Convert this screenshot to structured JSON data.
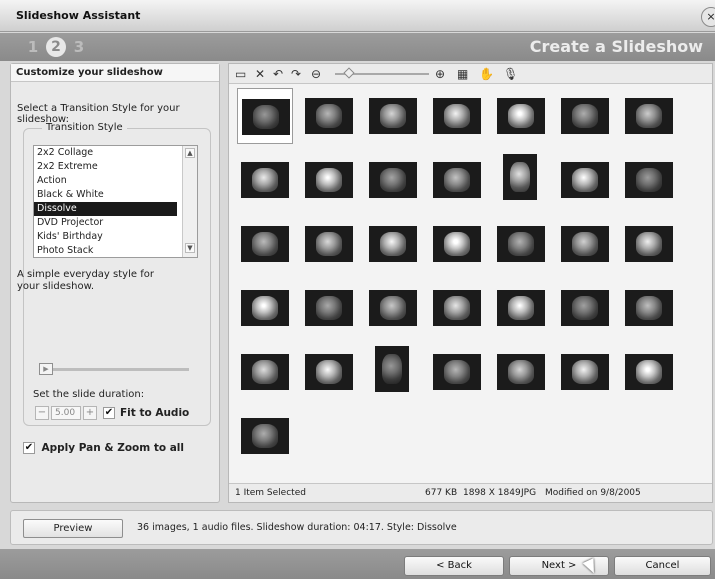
{
  "window": {
    "title": "Slideshow Assistant",
    "close_glyph": "×"
  },
  "wizard": {
    "steps": [
      "1",
      "2",
      "3"
    ],
    "active_step": "2",
    "heading": "Create a Slideshow"
  },
  "left_panel": {
    "title": "Customize your slideshow",
    "prompt": "Select a Transition Style for your slideshow:",
    "group_label": "Transition Style",
    "styles": [
      "2x2 Collage",
      "2x2 Extreme",
      "Action",
      "Black & White",
      "Dissolve",
      "DVD Projector",
      "Kids' Birthday",
      "Photo Stack"
    ],
    "selected_style": "Dissolve",
    "description": "A simple everyday style for your slideshow.",
    "duration_label": "Set the slide duration:",
    "duration_value": "5.00",
    "fit_to_audio_label": "Fit to Audio",
    "fit_to_audio_checked": true,
    "pan_zoom_label": "Apply Pan & Zoom to all",
    "pan_zoom_checked": true
  },
  "toolbar": {
    "icons": [
      "monitor-icon",
      "delete-icon",
      "rotate-left-icon",
      "rotate-right-icon",
      "zoom-out-icon",
      "zoom-slider",
      "zoom-in-icon",
      "view-options-icon",
      "pan-hand-icon",
      "microphone-icon"
    ]
  },
  "photos": {
    "count": 36,
    "selected_index": 0
  },
  "status": {
    "selection": "1 Item Selected",
    "size": "677 KB",
    "dimensions": "1898 X 1849",
    "format": "JPG",
    "modified": "Modified on 9/8/2005"
  },
  "info": {
    "preview_label": "Preview",
    "summary": "36 images,  1 audio files. Slideshow duration: 04:17. Style: Dissolve"
  },
  "footer": {
    "back_label": "< Back",
    "next_label": "Next  >",
    "cancel_label": "Cancel"
  },
  "colors": {
    "header_gray": "#8a8a8a",
    "selected_item": "#1a1a1a"
  }
}
